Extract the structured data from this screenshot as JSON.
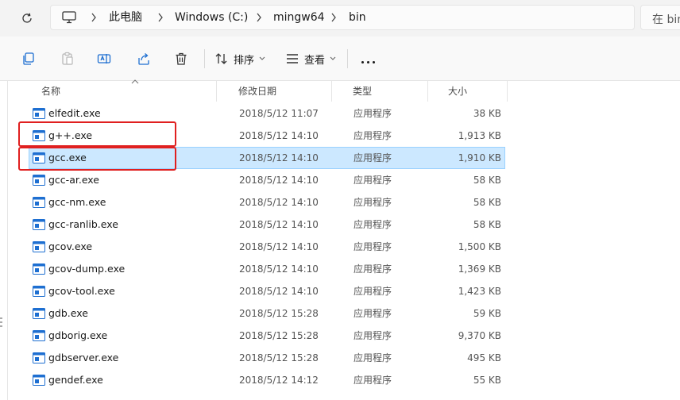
{
  "address_bar": {
    "breadcrumbs": [
      "此电脑",
      "Windows (C:)",
      "mingw64",
      "bin"
    ],
    "search_placeholder": "在 bin"
  },
  "toolbar": {
    "sort_label": "排序",
    "view_label": "查看",
    "icons": [
      "copy-icon",
      "paste-icon",
      "rename-icon",
      "share-icon",
      "delete-icon",
      "sort-icon",
      "view-icon",
      "more-icon"
    ]
  },
  "columns": {
    "name": "名称",
    "date": "修改日期",
    "type": "类型",
    "size": "大小"
  },
  "files": [
    {
      "name": "elfedit.exe",
      "date": "2018/5/12 11:07",
      "type": "应用程序",
      "size": "38 KB"
    },
    {
      "name": "g++.exe",
      "date": "2018/5/12 14:10",
      "type": "应用程序",
      "size": "1,913 KB"
    },
    {
      "name": "gcc.exe",
      "date": "2018/5/12 14:10",
      "type": "应用程序",
      "size": "1,910 KB"
    },
    {
      "name": "gcc-ar.exe",
      "date": "2018/5/12 14:10",
      "type": "应用程序",
      "size": "58 KB"
    },
    {
      "name": "gcc-nm.exe",
      "date": "2018/5/12 14:10",
      "type": "应用程序",
      "size": "58 KB"
    },
    {
      "name": "gcc-ranlib.exe",
      "date": "2018/5/12 14:10",
      "type": "应用程序",
      "size": "58 KB"
    },
    {
      "name": "gcov.exe",
      "date": "2018/5/12 14:10",
      "type": "应用程序",
      "size": "1,500 KB"
    },
    {
      "name": "gcov-dump.exe",
      "date": "2018/5/12 14:10",
      "type": "应用程序",
      "size": "1,369 KB"
    },
    {
      "name": "gcov-tool.exe",
      "date": "2018/5/12 14:10",
      "type": "应用程序",
      "size": "1,423 KB"
    },
    {
      "name": "gdb.exe",
      "date": "2018/5/12 15:28",
      "type": "应用程序",
      "size": "59 KB"
    },
    {
      "name": "gdborig.exe",
      "date": "2018/5/12 15:28",
      "type": "应用程序",
      "size": "9,370 KB"
    },
    {
      "name": "gdbserver.exe",
      "date": "2018/5/12 15:28",
      "type": "应用程序",
      "size": "495 KB"
    },
    {
      "name": "gendef.exe",
      "date": "2018/5/12 14:12",
      "type": "应用程序",
      "size": "55 KB"
    }
  ],
  "selected_file": "gcc.exe",
  "highlighted_files": [
    "g++.exe",
    "gcc.exe"
  ],
  "colors": {
    "selection_bg": "#cce8ff",
    "selection_border": "#99d1ff",
    "highlight_box": "#e02020",
    "exe_icon_blue": "#1e6fd1"
  }
}
